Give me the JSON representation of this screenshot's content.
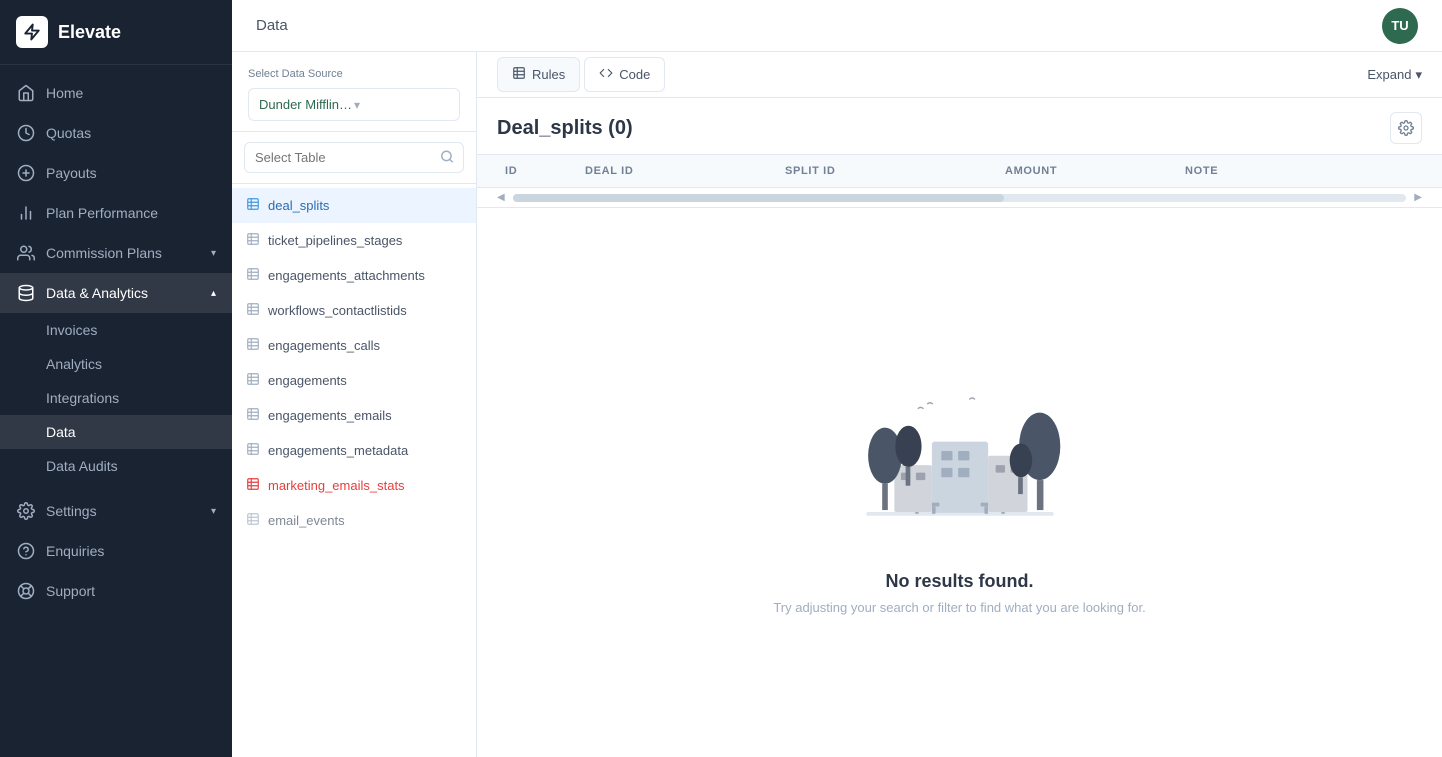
{
  "app": {
    "name": "Elevate",
    "user_initials": "TU"
  },
  "topbar": {
    "title": "Data"
  },
  "sidebar": {
    "items": [
      {
        "id": "home",
        "label": "Home",
        "icon": "home"
      },
      {
        "id": "quotas",
        "label": "Quotas",
        "icon": "quotas"
      },
      {
        "id": "payouts",
        "label": "Payouts",
        "icon": "payouts"
      },
      {
        "id": "plan-performance",
        "label": "Plan Performance",
        "icon": "chart"
      },
      {
        "id": "commission-plans",
        "label": "Commission Plans",
        "icon": "commission",
        "has_chevron": true
      },
      {
        "id": "data-analytics",
        "label": "Data & Analytics",
        "icon": "data",
        "has_chevron": true,
        "active": true
      }
    ],
    "sub_items": [
      {
        "id": "invoices",
        "label": "Invoices"
      },
      {
        "id": "analytics",
        "label": "Analytics"
      },
      {
        "id": "integrations",
        "label": "Integrations"
      },
      {
        "id": "data",
        "label": "Data",
        "active": true
      },
      {
        "id": "data-audits",
        "label": "Data Audits"
      }
    ],
    "bottom_items": [
      {
        "id": "settings",
        "label": "Settings",
        "icon": "settings",
        "has_chevron": true
      },
      {
        "id": "enquiries",
        "label": "Enquiries",
        "icon": "enquiries"
      },
      {
        "id": "support",
        "label": "Support",
        "icon": "support"
      }
    ]
  },
  "left_panel": {
    "source_label": "Select Data Source",
    "datasource_value": "Dunder Mifflin Paper company Hubs...",
    "search_placeholder": "Select Table",
    "tables": [
      {
        "id": "deal_splits",
        "name": "deal_splits",
        "active": true,
        "color": "normal"
      },
      {
        "id": "ticket_pipelines_stages",
        "name": "ticket_pipelines_stages",
        "color": "normal"
      },
      {
        "id": "engagements_attachments",
        "name": "engagements_attachments",
        "color": "normal"
      },
      {
        "id": "workflows_contactlistids",
        "name": "workflows_contactlistids",
        "color": "normal"
      },
      {
        "id": "engagements_calls",
        "name": "engagements_calls",
        "color": "normal"
      },
      {
        "id": "engagements",
        "name": "engagements",
        "color": "normal"
      },
      {
        "id": "engagements_emails",
        "name": "engagements_emails",
        "color": "normal"
      },
      {
        "id": "engagements_metadata",
        "name": "engagements_metadata",
        "color": "normal"
      },
      {
        "id": "marketing_emails_stats",
        "name": "marketing_emails_stats",
        "color": "red"
      },
      {
        "id": "email_events",
        "name": "email_events",
        "color": "normal"
      }
    ]
  },
  "right_panel": {
    "tabs": [
      {
        "id": "rules",
        "label": "Rules",
        "icon": "rules",
        "active": true
      },
      {
        "id": "code",
        "label": "Code",
        "icon": "code"
      }
    ],
    "expand_label": "Expand",
    "table_title": "Deal_splits (0)",
    "columns": [
      {
        "id": "id",
        "label": "ID"
      },
      {
        "id": "deal_id",
        "label": "DEAL ID"
      },
      {
        "id": "split_id",
        "label": "SPLIT ID"
      },
      {
        "id": "amount",
        "label": "AMOUNT"
      },
      {
        "id": "note",
        "label": "NOTE"
      }
    ],
    "empty_state": {
      "title": "No results found.",
      "subtitle": "Try adjusting your search or filter to find what you are looking for."
    }
  }
}
